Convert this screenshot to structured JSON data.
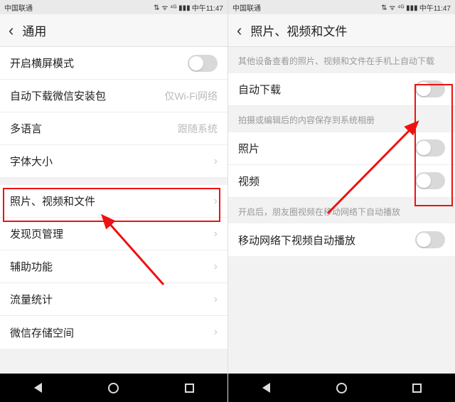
{
  "status": {
    "carrier": "中国联通",
    "icons": "⇅ ᯤ ⁴ᴳ ▮▮▮",
    "time": "中午11:47"
  },
  "left": {
    "title": "通用",
    "rows": [
      {
        "label": "开启横屏模式",
        "type": "toggle",
        "on": false
      },
      {
        "label": "自动下载微信安装包",
        "type": "value",
        "value": "仅Wi-Fi网络"
      },
      {
        "label": "多语言",
        "type": "value",
        "value": "跟随系统"
      },
      {
        "label": "字体大小",
        "type": "chevron"
      },
      {
        "label": "照片、视频和文件",
        "type": "chevron"
      },
      {
        "label": "发现页管理",
        "type": "chevron"
      },
      {
        "label": "辅助功能",
        "type": "chevron"
      },
      {
        "label": "流量统计",
        "type": "chevron"
      },
      {
        "label": "微信存储空间",
        "type": "chevron"
      }
    ]
  },
  "right": {
    "title": "照片、视频和文件",
    "note1": "其他设备查看的照片、视频和文件在手机上自动下载",
    "row_auto": "自动下载",
    "note2": "拍摄或编辑后的内容保存到系统相册",
    "row_photo": "照片",
    "row_video": "视频",
    "note3": "开启后，朋友圈视频在移动网络下自动播放",
    "row_mobile": "移动网络下视频自动播放"
  }
}
